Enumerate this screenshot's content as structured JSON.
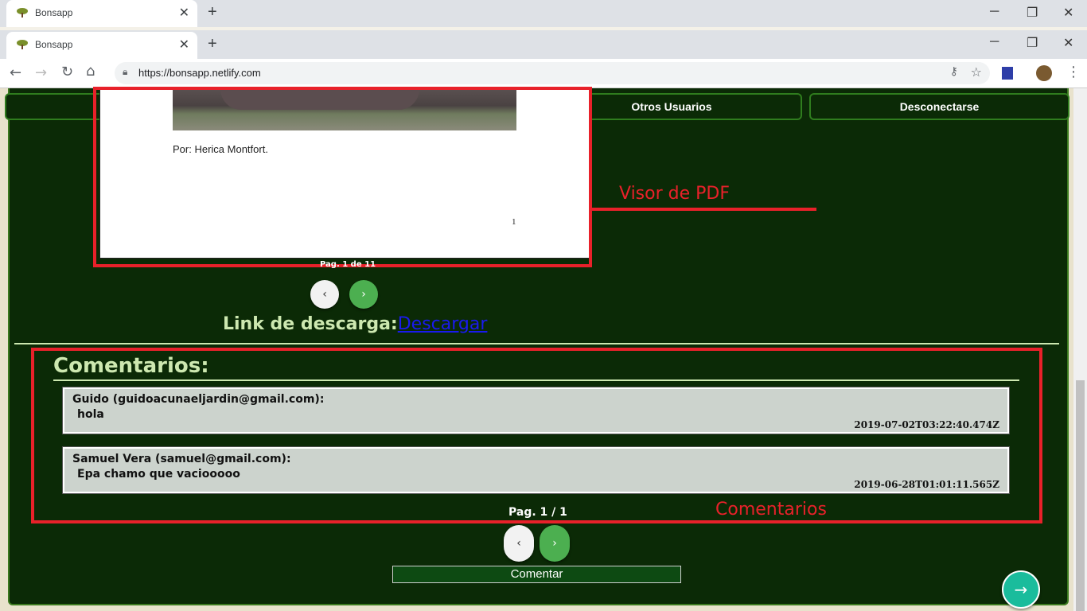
{
  "browser": {
    "tabs": [
      {
        "title": "Bonsapp"
      },
      {
        "title": "Bonsapp"
      }
    ],
    "url": "https://bonsapp.netlify.com",
    "new_tab_label": "+",
    "close_label": "✕",
    "minimize_label": "─",
    "restore_label": "❐",
    "window_close_label": "✕"
  },
  "nav": {
    "other_users": "Otros Usuarios",
    "logout": "Desconectarse"
  },
  "pdf_viewer": {
    "author_line": "Por: Herica Montfort.",
    "page_number": "1",
    "page_indicator": "Pag. 1 de 11",
    "prev": "‹",
    "next": "›"
  },
  "download": {
    "label": "Link de descarga:",
    "link": "Descargar"
  },
  "comments": {
    "heading": "Comentarios:",
    "items": [
      {
        "author": "Guido (guidoacunaeljardin@gmail.com):",
        "body": "hola",
        "time": "2019-07-02T03:22:40.474Z"
      },
      {
        "author": "Samuel Vera (samuel@gmail.com):",
        "body": "Epa chamo que vaciooooo",
        "time": "2019-06-28T01:01:11.565Z"
      }
    ],
    "pagination": "Pag. 1 / 1",
    "prev": "‹",
    "next": "›",
    "comment_button": "Comentar"
  },
  "annotations": {
    "pdf_label": "Visor de PDF",
    "comments_label": "Comentarios"
  },
  "fab": {
    "label": "→"
  },
  "colors": {
    "annotation": "#e8212a",
    "panel": "#0b2a06",
    "accent_green": "#4caf50",
    "fab": "#1abc9c"
  }
}
